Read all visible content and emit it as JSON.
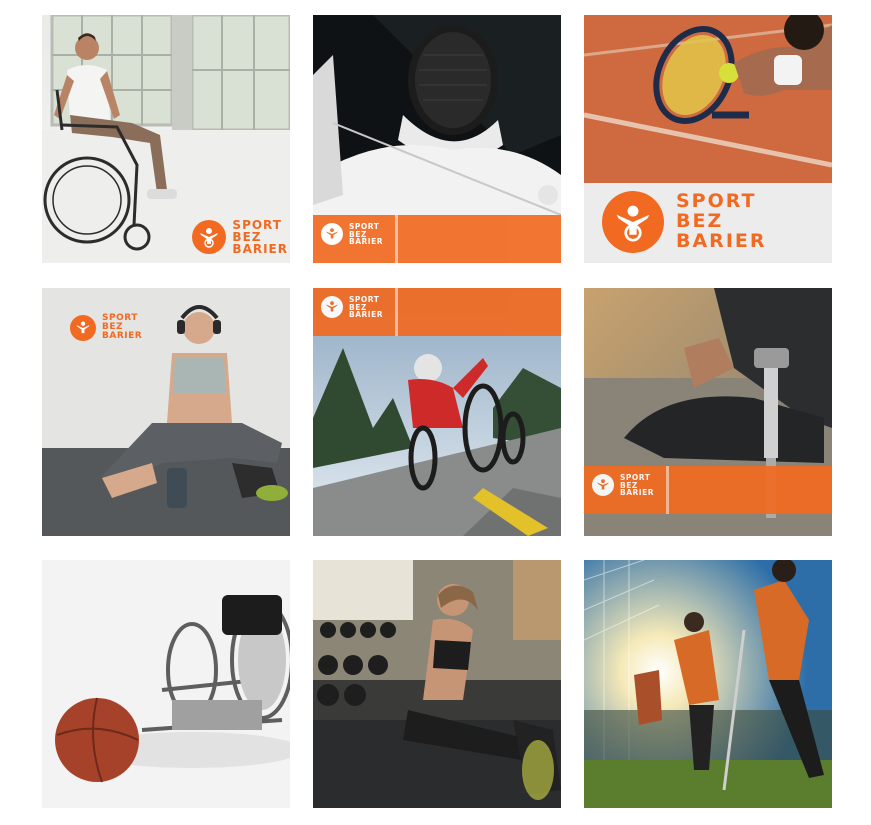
{
  "brand": {
    "name_lines": [
      "SPORT",
      "BEZ",
      "BARIER"
    ],
    "accent_color": "#f26a21"
  },
  "feed": {
    "tiles": [
      {
        "subject": "wheelchair-user-portrait",
        "logo": "bottom-right"
      },
      {
        "subject": "fencer-in-mask",
        "logo": "bottom-band"
      },
      {
        "subject": "tennis-racket-and-ball",
        "logo": "bottom-panel-large"
      },
      {
        "subject": "athlete-with-prosthetic-legs-sitting",
        "logo": "top-left"
      },
      {
        "subject": "handcyclist-on-road",
        "logo": "top-band"
      },
      {
        "subject": "athlete-with-prosthetic-leg-kneeling",
        "logo": "bottom-band"
      },
      {
        "subject": "sport-wheelchair-and-ball",
        "logo": "none"
      },
      {
        "subject": "woman-stretching-in-gym",
        "logo": "none"
      },
      {
        "subject": "amputee-football-players",
        "logo": "none"
      }
    ]
  }
}
